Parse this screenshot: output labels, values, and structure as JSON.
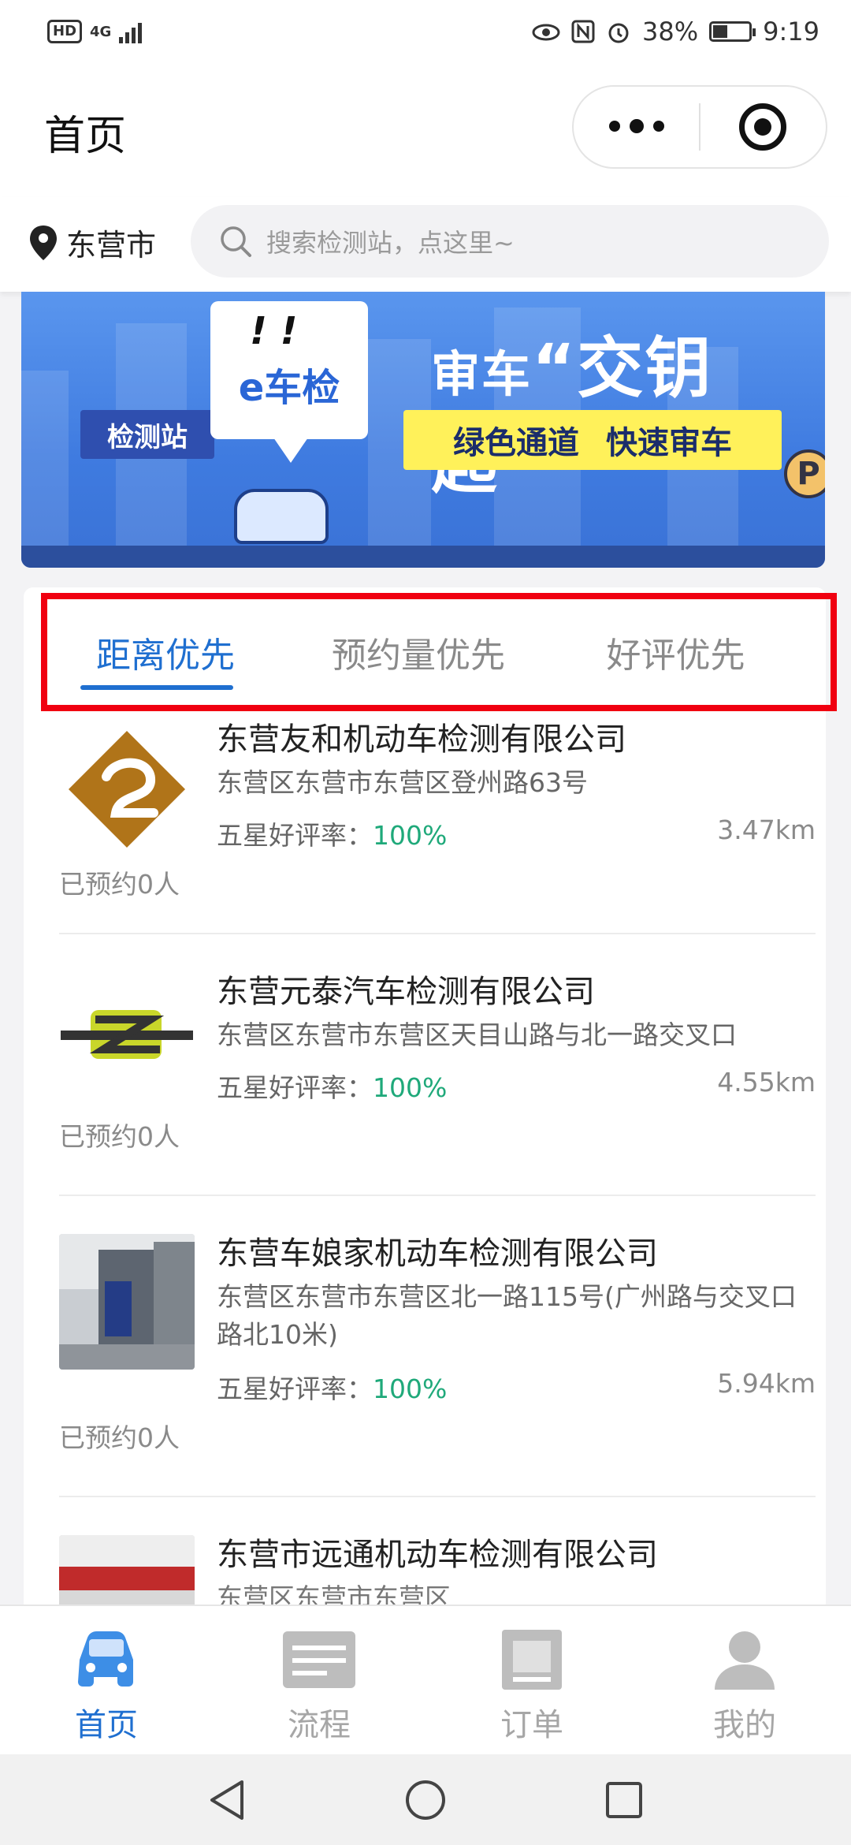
{
  "status_bar": {
    "hd": "HD",
    "network": "4G",
    "battery": "38%",
    "time": "9:19"
  },
  "header": {
    "title": "首页"
  },
  "location": {
    "city": "东营市"
  },
  "search": {
    "placeholder": "搜索检测站，点这里~"
  },
  "banner": {
    "station_sign": "检测站",
    "app_logo": "e车检",
    "slogan_prefix": "审车",
    "slogan_quote_open": "“",
    "slogan_main": "交钥匙",
    "slogan_quote_close": "”",
    "tag_1": "绿色通道",
    "tag_2": "快速审车",
    "parking_sign": "P"
  },
  "sort_tabs": [
    {
      "label": "距离优先",
      "active": true
    },
    {
      "label": "预约量优先",
      "active": false
    },
    {
      "label": "好评优先",
      "active": false
    }
  ],
  "rating_label": "五星好评率：",
  "stations": [
    {
      "name": "东营友和机动车检测有限公司",
      "address": "东营区东营市东营区登州路63号",
      "rating": "100%",
      "distance": "3.47km",
      "booked": "已预约0人"
    },
    {
      "name": "东营元泰汽车检测有限公司",
      "address": "东营区东营市东营区天目山路与北一路交叉口",
      "rating": "100%",
      "distance": "4.55km",
      "booked": "已预约0人"
    },
    {
      "name": "东营车娘家机动车检测有限公司",
      "address": "东营区东营市东营区北一路115号(广州路与交叉口路北10米)",
      "rating": "100%",
      "distance": "5.94km",
      "booked": "已预约0人"
    },
    {
      "name": "东营市远通机动车检测有限公司",
      "address": "东营区东营市东营区",
      "rating": "",
      "distance": "",
      "booked": ""
    }
  ],
  "tabbar": [
    {
      "label": "首页",
      "icon": "car-icon",
      "active": true
    },
    {
      "label": "流程",
      "icon": "process-icon",
      "active": false
    },
    {
      "label": "订单",
      "icon": "order-icon",
      "active": false
    },
    {
      "label": "我的",
      "icon": "profile-icon",
      "active": false
    }
  ],
  "colors": {
    "accent": "#1f6fd0",
    "rating_green": "#1fa97a",
    "highlight": "#f00010"
  }
}
